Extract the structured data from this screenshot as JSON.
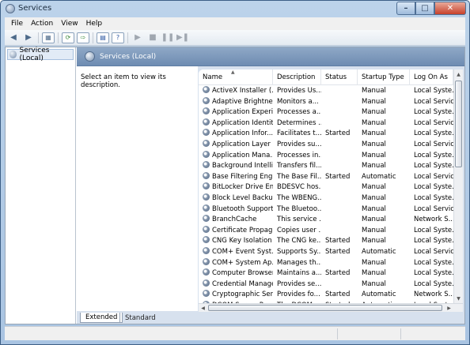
{
  "window": {
    "title": "Services"
  },
  "menu": [
    "File",
    "Action",
    "View",
    "Help"
  ],
  "toolbar": {
    "icons": [
      "back-arrow-icon",
      "forward-arrow-icon",
      "show-hide-tree-icon",
      "refresh-icon",
      "export-list-icon",
      "properties-icon",
      "help-icon",
      "start-service-icon",
      "stop-service-icon",
      "pause-service-icon",
      "restart-service-icon"
    ]
  },
  "tree": {
    "root_label": "Services (Local)"
  },
  "panel": {
    "title": "Services (Local)",
    "description": "Select an item to view its description."
  },
  "columns": [
    "Name",
    "Description",
    "Status",
    "Startup Type",
    "Log On As"
  ],
  "services": [
    [
      "ActiveX Installer (...",
      "Provides Us...",
      "",
      "Manual",
      "Local Syste..."
    ],
    [
      "Adaptive Brightness",
      "Monitors a...",
      "",
      "Manual",
      "Local Service"
    ],
    [
      "Application Experi...",
      "Processes a...",
      "",
      "Manual",
      "Local Syste..."
    ],
    [
      "Application Identity",
      "Determines ...",
      "",
      "Manual",
      "Local Service"
    ],
    [
      "Application Infor...",
      "Facilitates t...",
      "Started",
      "Manual",
      "Local Syste..."
    ],
    [
      "Application Layer ...",
      "Provides su...",
      "",
      "Manual",
      "Local Service"
    ],
    [
      "Application Mana...",
      "Processes in...",
      "",
      "Manual",
      "Local Syste..."
    ],
    [
      "Background Intelli...",
      "Transfers fil...",
      "",
      "Manual",
      "Local Syste..."
    ],
    [
      "Base Filtering Engi...",
      "The Base Fil...",
      "Started",
      "Automatic",
      "Local Service"
    ],
    [
      "BitLocker Drive En...",
      "BDESVC hos...",
      "",
      "Manual",
      "Local Syste..."
    ],
    [
      "Block Level Backu...",
      "The WBENG...",
      "",
      "Manual",
      "Local Syste..."
    ],
    [
      "Bluetooth Support...",
      "The Bluetoo...",
      "",
      "Manual",
      "Local Service"
    ],
    [
      "BranchCache",
      "This service ...",
      "",
      "Manual",
      "Network S..."
    ],
    [
      "Certificate Propag...",
      "Copies user ...",
      "",
      "Manual",
      "Local Syste..."
    ],
    [
      "CNG Key Isolation",
      "The CNG ke...",
      "Started",
      "Manual",
      "Local Syste..."
    ],
    [
      "COM+ Event Syst...",
      "Supports Sy...",
      "Started",
      "Automatic",
      "Local Service"
    ],
    [
      "COM+ System Ap...",
      "Manages th...",
      "",
      "Manual",
      "Local Syste..."
    ],
    [
      "Computer Browser",
      "Maintains a...",
      "Started",
      "Manual",
      "Local Syste..."
    ],
    [
      "Credential Manager",
      "Provides se...",
      "",
      "Manual",
      "Local Syste..."
    ],
    [
      "Cryptographic Ser...",
      "Provides fo...",
      "Started",
      "Automatic",
      "Network S..."
    ],
    [
      "DCOM Server Pro...",
      "The DCOM...",
      "Started",
      "Automatic",
      "Local Syste..."
    ]
  ],
  "tabs": {
    "extended": "Extended",
    "standard": "Standard"
  }
}
